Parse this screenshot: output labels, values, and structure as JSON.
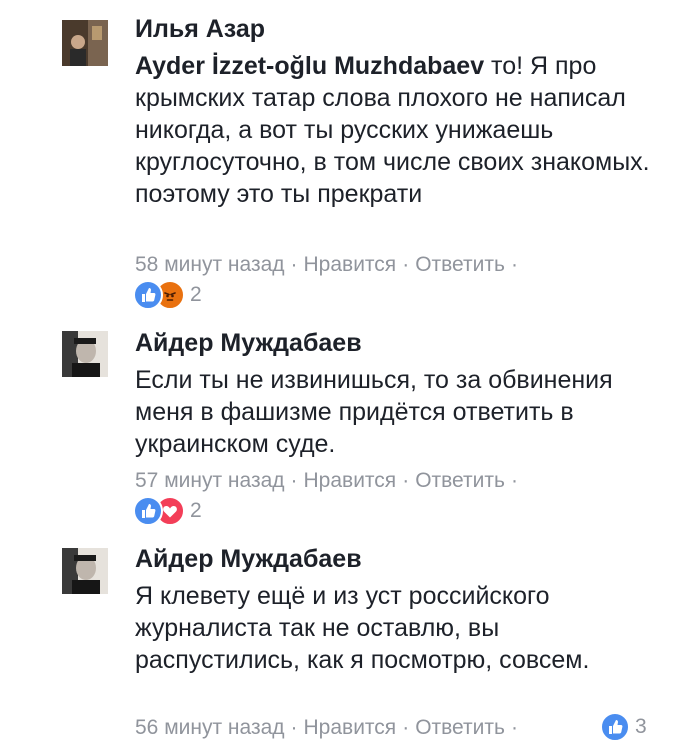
{
  "comments": [
    {
      "author": "Илья Азар",
      "mention": "Ayder İzzet-oğlu Muzhdabaev",
      "text": " то! Я про крымских татар слова плохого не написал никогда, а вот ты русских унижаешь круглосуточно, в том числе своих знакомых. поэтому это ты прекрати",
      "time": "58 минут назад",
      "like_label": "Нравится",
      "reply_label": "Ответить",
      "reactions": [
        "like-icon",
        "angry-icon"
      ],
      "reaction_count": "2"
    },
    {
      "author": "Айдер Муждабаев",
      "text": "Если ты не извинишься, то за обвинения меня в фашизме придётся ответить в украинском суде.",
      "time": "57 минут назад",
      "like_label": "Нравится",
      "reply_label": "Ответить",
      "reactions": [
        "like-icon",
        "love-icon"
      ],
      "reaction_count": "2"
    },
    {
      "author": "Айдер Муждабаев",
      "text": "Я клевету ещё и из уст российского журналиста так не оставлю, вы распустились, как я посмотрю, совсем.",
      "time": "56 минут назад",
      "like_label": "Нравится",
      "reply_label": "Ответить",
      "reactions": [
        "like-icon"
      ],
      "reaction_count": "3"
    }
  ],
  "colors": {
    "text": "#1d2129",
    "meta": "#90949c",
    "like": "#4a8df0",
    "angry": "#e9710f",
    "love": "#f33e58"
  }
}
